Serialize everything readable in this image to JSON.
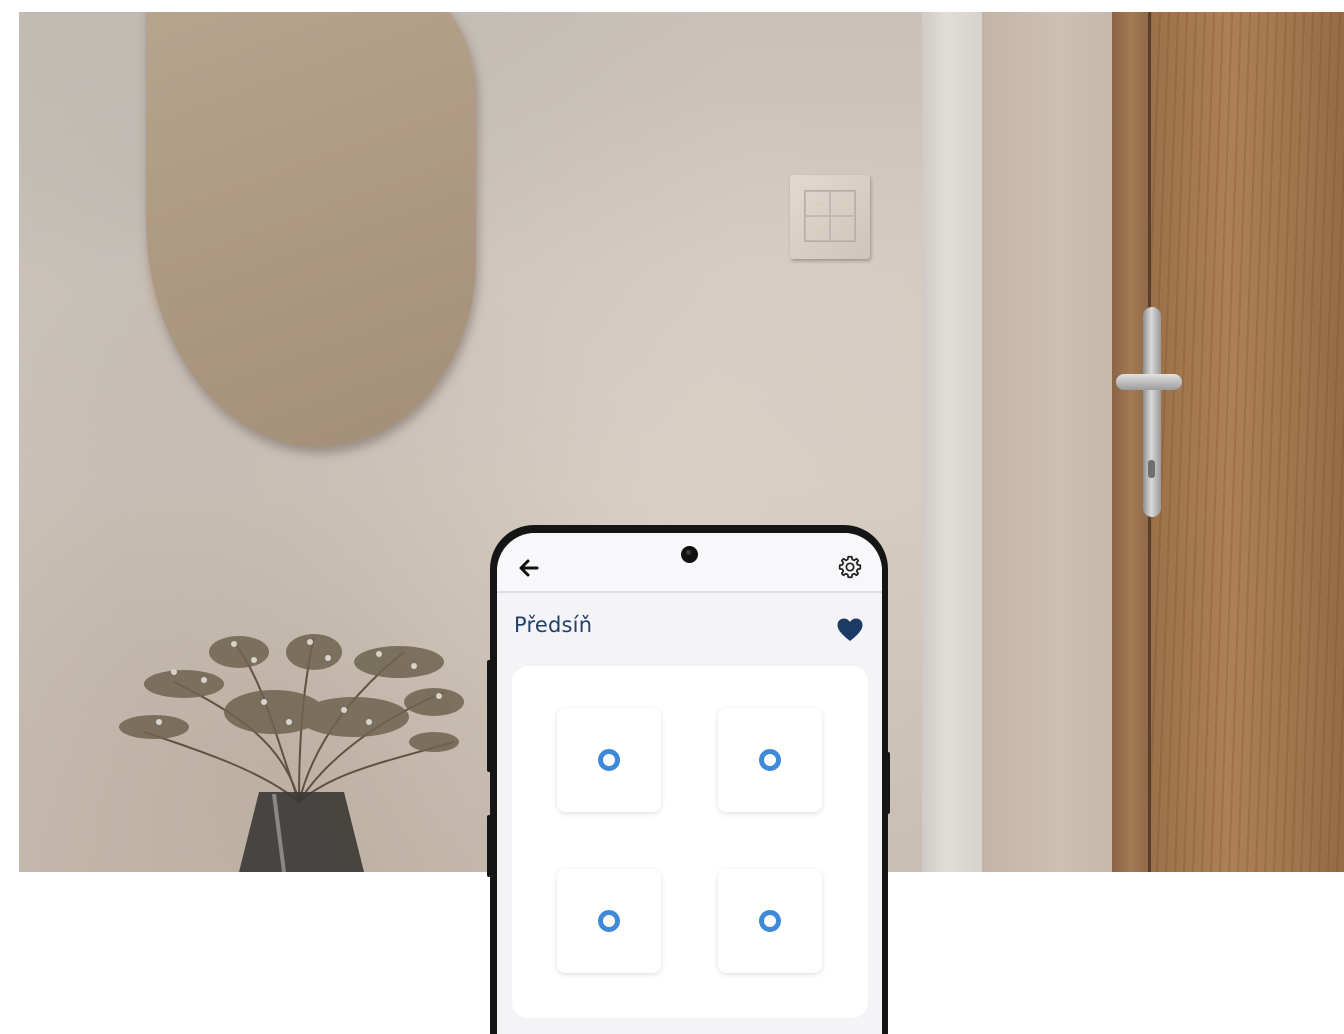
{
  "app": {
    "room_title": "Předsíň",
    "favorite": true
  },
  "icons": {
    "back": "arrow-left-icon",
    "settings": "gear-icon",
    "favorite": "heart-icon",
    "switch_indicator": "ring-indicator-icon"
  },
  "switch_buttons": [
    {
      "id": "top-left"
    },
    {
      "id": "top-right"
    },
    {
      "id": "bottom-left"
    },
    {
      "id": "bottom-right"
    }
  ],
  "colors": {
    "title": "#23406b",
    "accent": "#3f8ad8",
    "heart": "#1d3a66"
  }
}
